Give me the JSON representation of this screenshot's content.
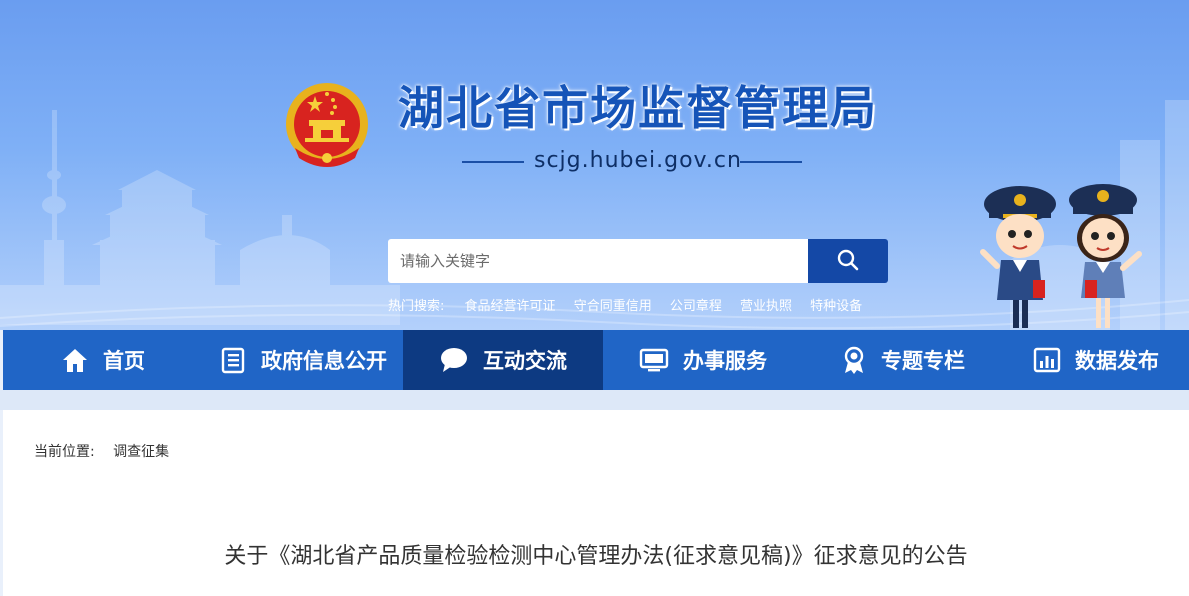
{
  "header": {
    "site_title": "湖北省市场监督管理局",
    "domain": "scjg.hubei.gov.cn",
    "search": {
      "placeholder": "请输入关键字",
      "button_icon": "search-icon"
    },
    "hot_search": {
      "label": "热门搜索:",
      "items": [
        "食品经营许可证",
        "守合同重信用",
        "公司章程",
        "营业执照",
        "特种设备"
      ]
    }
  },
  "nav": {
    "items": [
      {
        "label": "首页",
        "icon": "home-icon"
      },
      {
        "label": "政府信息公开",
        "icon": "document-list-icon"
      },
      {
        "label": "互动交流",
        "icon": "chat-bubble-icon",
        "active": true
      },
      {
        "label": "办事服务",
        "icon": "monitor-icon"
      },
      {
        "label": "专题专栏",
        "icon": "medal-icon"
      },
      {
        "label": "数据发布",
        "icon": "bar-chart-icon"
      }
    ]
  },
  "breadcrumb": {
    "label": "当前位置:",
    "current": "调查征集"
  },
  "article": {
    "title": "关于《湖北省产品质量检验检测中心管理办法(征求意见稿)》征求意见的公告"
  },
  "colors": {
    "nav_bg": "#2065c6",
    "nav_active": "#0d3a82",
    "title_blue": "#1554b8",
    "search_button": "#1448a6"
  }
}
